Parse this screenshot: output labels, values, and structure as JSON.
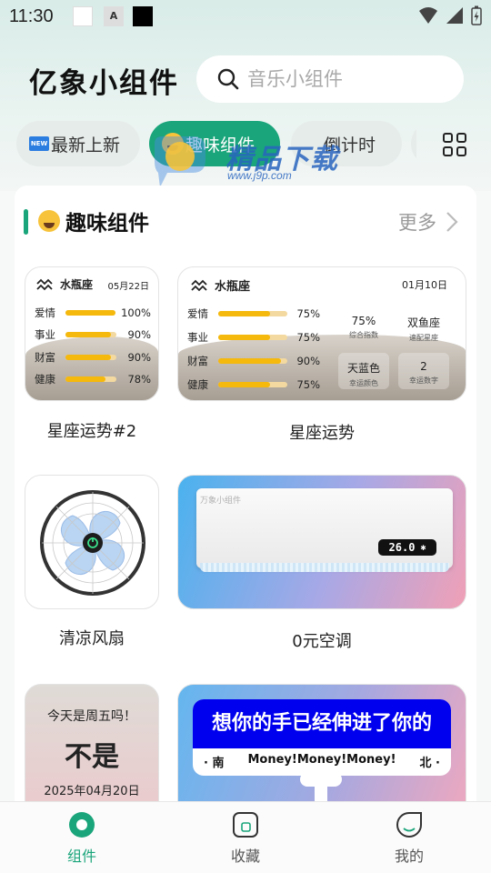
{
  "status_bar": {
    "time": "11:30",
    "icon_a": "A"
  },
  "header": {
    "app_title": "亿象小组件",
    "search_placeholder": "音乐小组件"
  },
  "tabs": [
    {
      "label": "最新上新",
      "icon": "new-badge-icon"
    },
    {
      "label": "趣味组件",
      "icon": "laughing-emoji-icon",
      "active": true
    },
    {
      "label": "倒计时",
      "icon": "clock-icon"
    }
  ],
  "watermark": {
    "text": "精品下载",
    "url": "www.j9p.com"
  },
  "section": {
    "title": "趣味组件",
    "more": "更多"
  },
  "widgets": {
    "zodiac_small": {
      "sign": "水瓶座",
      "date": "05月22日",
      "rows": [
        {
          "label": "爱情",
          "pct": "100%",
          "value": 1.0
        },
        {
          "label": "事业",
          "pct": "90%",
          "value": 0.9
        },
        {
          "label": "财富",
          "pct": "90%",
          "value": 0.9
        },
        {
          "label": "健康",
          "pct": "78%",
          "value": 0.78
        }
      ],
      "caption": "星座运势#2"
    },
    "zodiac_big": {
      "sign": "水瓶座",
      "date": "01月10日",
      "rows": [
        {
          "label": "爱情",
          "pct": "75%",
          "value": 0.75
        },
        {
          "label": "事业",
          "pct": "75%",
          "value": 0.75
        },
        {
          "label": "财富",
          "pct": "90%",
          "value": 0.9
        },
        {
          "label": "健康",
          "pct": "75%",
          "value": 0.75
        }
      ],
      "stats": [
        {
          "value": "75%",
          "label": "综合指数"
        },
        {
          "value": "双鱼座",
          "label": "速配星座"
        },
        {
          "value": "天蓝色",
          "label": "幸运颜色"
        },
        {
          "value": "2",
          "label": "幸运数字"
        }
      ],
      "caption": "星座运势"
    },
    "fan": {
      "caption": "清凉风扇"
    },
    "ac": {
      "brand": "万象小组件",
      "temp": "26.0",
      "caption": "0元空调"
    },
    "friday": {
      "question": "今天是周五吗！",
      "answer": "不是",
      "date": "2025年04月20日"
    },
    "money": {
      "banner": "想你的手已经伸进了你的",
      "left": "· 南",
      "middle": "Money!Money!Money!",
      "right": "北 ·"
    }
  },
  "bottom_nav": [
    {
      "label": "组件",
      "active": true
    },
    {
      "label": "收藏"
    },
    {
      "label": "我的"
    }
  ],
  "colors": {
    "accent": "#1aa57a",
    "bar": "#f5b80c",
    "banner": "#0000ee"
  }
}
